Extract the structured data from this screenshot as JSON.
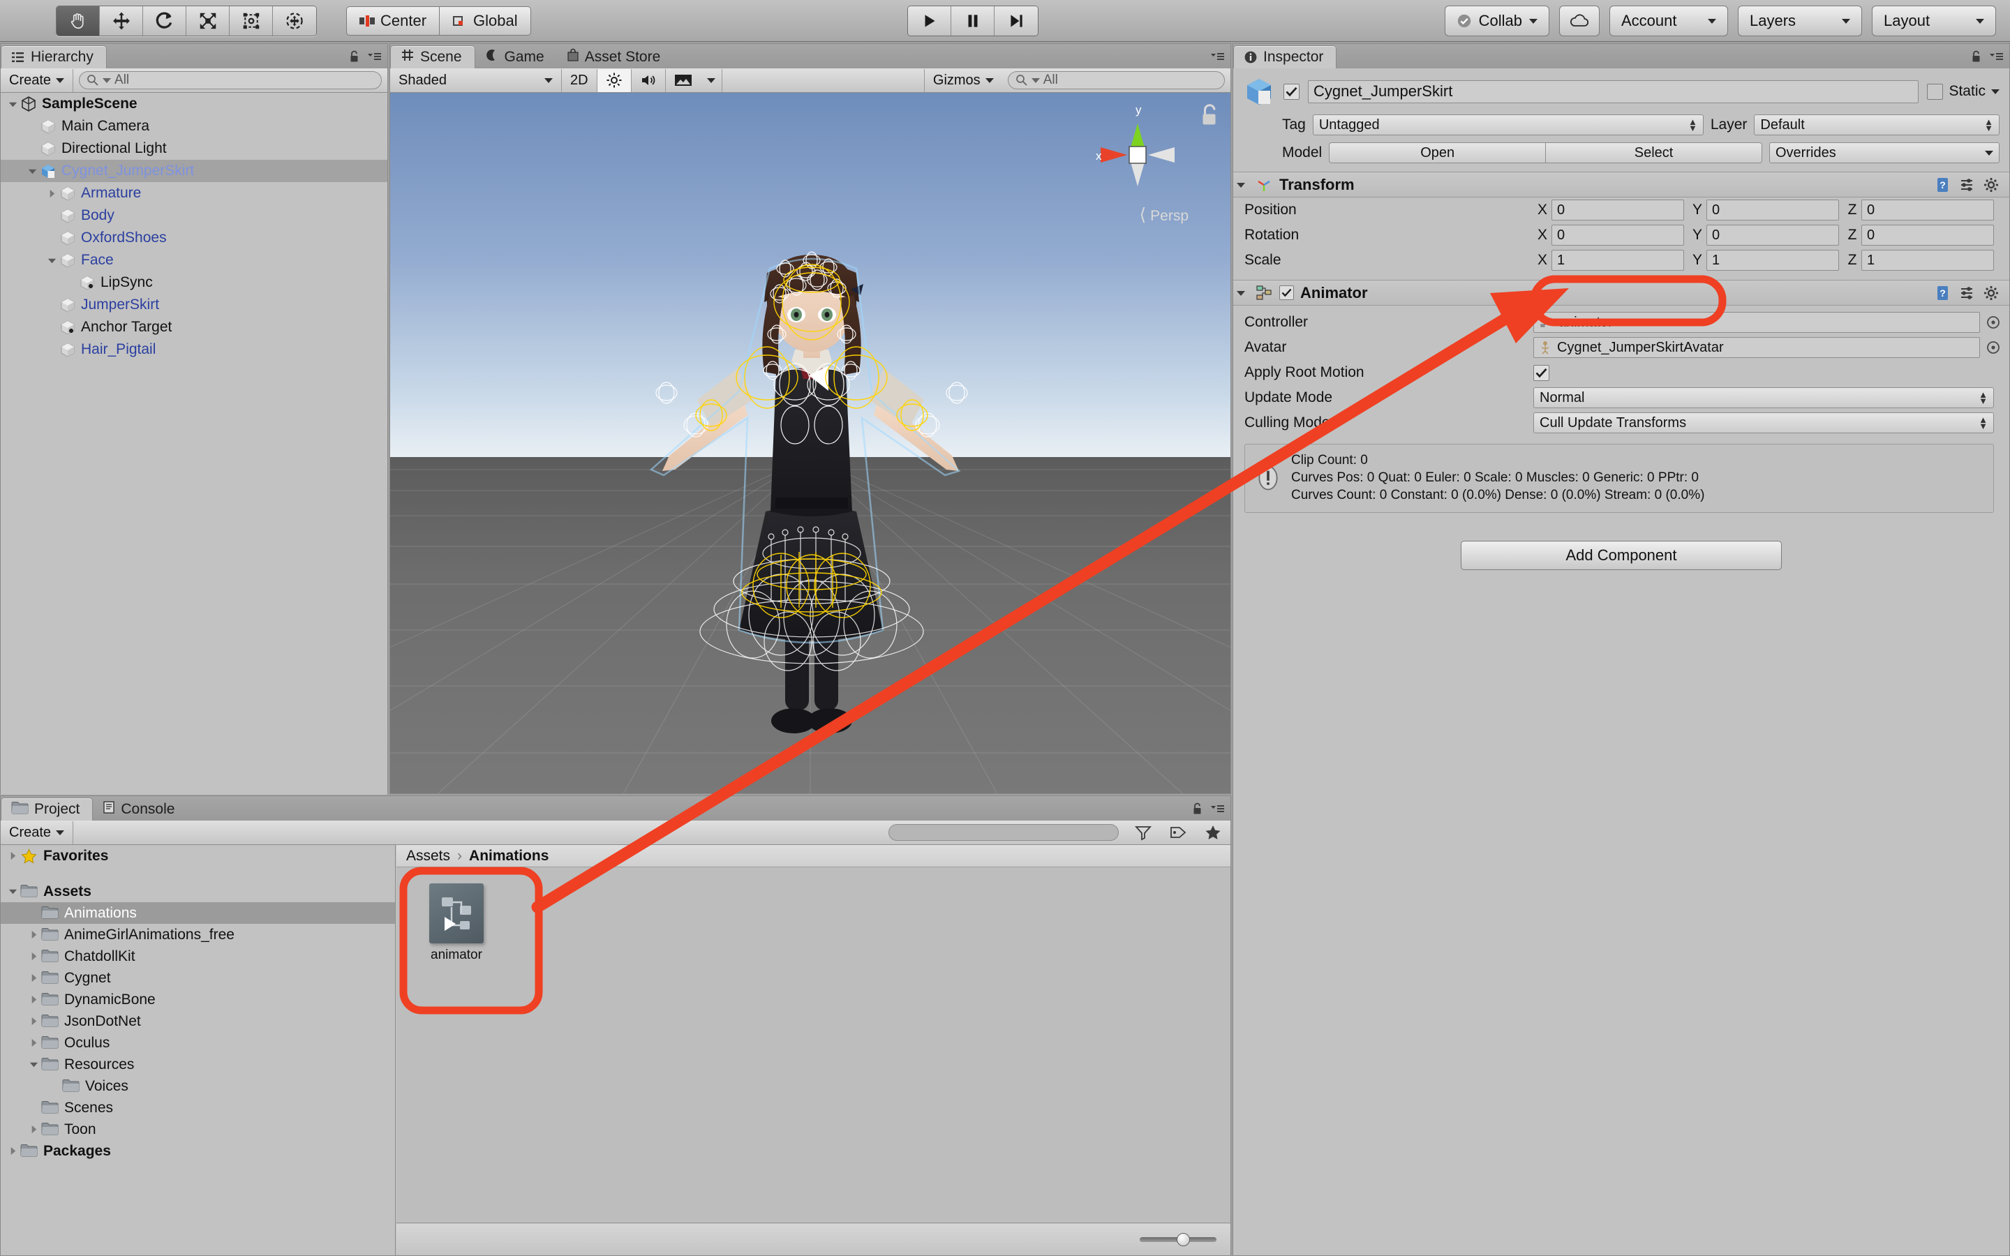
{
  "toolbar": {
    "tools": [
      {
        "name": "hand-tool",
        "icon": "hand",
        "active": true
      },
      {
        "name": "move-tool",
        "icon": "move",
        "active": false
      },
      {
        "name": "rotate-tool",
        "icon": "rotate",
        "active": false
      },
      {
        "name": "scale-tool",
        "icon": "scale",
        "active": false
      },
      {
        "name": "rect-tool",
        "icon": "rect",
        "active": false
      },
      {
        "name": "transform-tool",
        "icon": "transform",
        "active": false
      }
    ],
    "pivot_label": "Center",
    "space_label": "Global",
    "play_label": "play",
    "pause_label": "pause",
    "step_label": "step",
    "collab_label": "Collab",
    "cloud_label": "cloud",
    "account_label": "Account",
    "layers_label": "Layers",
    "layout_label": "Layout"
  },
  "hierarchy": {
    "tab_label": "Hierarchy",
    "create_label": "Create",
    "search_placeholder": "All",
    "items": [
      {
        "label": "SampleScene",
        "depth": 0,
        "arrow": "down",
        "icon": "unity",
        "style": "bold",
        "selected": false
      },
      {
        "label": "Main Camera",
        "depth": 1,
        "arrow": "none",
        "icon": "cube",
        "style": "normal",
        "selected": false
      },
      {
        "label": "Directional Light",
        "depth": 1,
        "arrow": "none",
        "icon": "cube",
        "style": "normal",
        "selected": false
      },
      {
        "label": "Cygnet_JumperSkirt",
        "depth": 1,
        "arrow": "down",
        "icon": "prefab",
        "style": "prefab-sel",
        "selected": true
      },
      {
        "label": "Armature",
        "depth": 2,
        "arrow": "right",
        "icon": "cube",
        "style": "prefab",
        "selected": false
      },
      {
        "label": "Body",
        "depth": 2,
        "arrow": "none",
        "icon": "cube",
        "style": "prefab",
        "selected": false
      },
      {
        "label": "OxfordShoes",
        "depth": 2,
        "arrow": "none",
        "icon": "cube",
        "style": "prefab",
        "selected": false
      },
      {
        "label": "Face",
        "depth": 2,
        "arrow": "down",
        "icon": "cube",
        "style": "prefab",
        "selected": false
      },
      {
        "label": "LipSync",
        "depth": 3,
        "arrow": "none",
        "icon": "cube-plus",
        "style": "normal",
        "selected": false
      },
      {
        "label": "JumperSkirt",
        "depth": 2,
        "arrow": "none",
        "icon": "cube",
        "style": "prefab",
        "selected": false
      },
      {
        "label": "Anchor Target",
        "depth": 2,
        "arrow": "none",
        "icon": "cube-plus",
        "style": "normal",
        "selected": false
      },
      {
        "label": "Hair_Pigtail",
        "depth": 2,
        "arrow": "none",
        "icon": "cube",
        "style": "prefab",
        "selected": false
      }
    ]
  },
  "scene": {
    "tabs": [
      {
        "label": "Scene",
        "icon": "grid-icon",
        "active": true
      },
      {
        "label": "Game",
        "icon": "gamepad-icon",
        "active": false
      },
      {
        "label": "Asset Store",
        "icon": "store-icon",
        "active": false
      }
    ],
    "draw_mode": "Shaded",
    "two_d_label": "2D",
    "lighting_icon": "sun-icon",
    "audio_icon": "speaker-icon",
    "effects_icon": "image-icon",
    "gizmos_label": "Gizmos",
    "search_placeholder": "All",
    "axis_x": "x",
    "axis_y": "y",
    "perspective_label": "Persp"
  },
  "inspector": {
    "tab_label": "Inspector",
    "object_name": "Cygnet_JumperSkirt",
    "enabled": true,
    "static_label": "Static",
    "tag_label": "Tag",
    "tag_value": "Untagged",
    "layer_label": "Layer",
    "layer_value": "Default",
    "model_label": "Model",
    "model_open": "Open",
    "model_select": "Select",
    "model_overrides": "Overrides",
    "transform": {
      "title": "Transform",
      "rows": [
        {
          "label": "Position",
          "x": "0",
          "y": "0",
          "z": "0"
        },
        {
          "label": "Rotation",
          "x": "0",
          "y": "0",
          "z": "0"
        },
        {
          "label": "Scale",
          "x": "1",
          "y": "1",
          "z": "1"
        }
      ],
      "axis_labels": [
        "X",
        "Y",
        "Z"
      ]
    },
    "animator": {
      "title": "Animator",
      "enabled": true,
      "controller_label": "Controller",
      "controller_value": "animator",
      "avatar_label": "Avatar",
      "avatar_value": "Cygnet_JumperSkirtAvatar",
      "apply_root_motion_label": "Apply Root Motion",
      "apply_root_motion_value": true,
      "update_mode_label": "Update Mode",
      "update_mode_value": "Normal",
      "culling_mode_label": "Culling Mode",
      "culling_mode_value": "Cull Update Transforms",
      "info_lines": [
        "Clip Count: 0",
        "Curves Pos: 0 Quat: 0 Euler: 0 Scale: 0 Muscles: 0 Generic: 0 PPtr: 0",
        "Curves Count: 0 Constant: 0 (0.0%) Dense: 0 (0.0%) Stream: 0 (0.0%)"
      ]
    },
    "add_component_label": "Add Component"
  },
  "project": {
    "tabs": [
      {
        "label": "Project",
        "icon": "folder-icon",
        "active": true
      },
      {
        "label": "Console",
        "icon": "console-icon",
        "active": false
      }
    ],
    "create_label": "Create",
    "tree": [
      {
        "label": "Favorites",
        "depth": 0,
        "arrow": "right",
        "icon": "star",
        "style": "bold",
        "selected": false
      },
      {
        "label": "",
        "depth": 0,
        "arrow": "none",
        "icon": "none",
        "style": "spacer",
        "selected": false
      },
      {
        "label": "Assets",
        "depth": 0,
        "arrow": "down",
        "icon": "folder",
        "style": "bold",
        "selected": false
      },
      {
        "label": "Animations",
        "depth": 1,
        "arrow": "none",
        "icon": "folder",
        "style": "normal",
        "selected": true
      },
      {
        "label": "AnimeGirlAnimations_free",
        "depth": 1,
        "arrow": "right",
        "icon": "folder",
        "style": "normal",
        "selected": false
      },
      {
        "label": "ChatdollKit",
        "depth": 1,
        "arrow": "right",
        "icon": "folder",
        "style": "normal",
        "selected": false
      },
      {
        "label": "Cygnet",
        "depth": 1,
        "arrow": "right",
        "icon": "folder",
        "style": "normal",
        "selected": false
      },
      {
        "label": "DynamicBone",
        "depth": 1,
        "arrow": "right",
        "icon": "folder",
        "style": "normal",
        "selected": false
      },
      {
        "label": "JsonDotNet",
        "depth": 1,
        "arrow": "right",
        "icon": "folder",
        "style": "normal",
        "selected": false
      },
      {
        "label": "Oculus",
        "depth": 1,
        "arrow": "right",
        "icon": "folder",
        "style": "normal",
        "selected": false
      },
      {
        "label": "Resources",
        "depth": 1,
        "arrow": "down",
        "icon": "folder",
        "style": "normal",
        "selected": false
      },
      {
        "label": "Voices",
        "depth": 2,
        "arrow": "none",
        "icon": "folder",
        "style": "normal",
        "selected": false
      },
      {
        "label": "Scenes",
        "depth": 1,
        "arrow": "none",
        "icon": "folder",
        "style": "normal",
        "selected": false
      },
      {
        "label": "Toon",
        "depth": 1,
        "arrow": "right",
        "icon": "folder",
        "style": "normal",
        "selected": false
      },
      {
        "label": "Packages",
        "depth": 0,
        "arrow": "right",
        "icon": "folder",
        "style": "bold",
        "selected": false
      }
    ],
    "breadcrumb": [
      "Assets",
      "Animations"
    ],
    "assets": [
      {
        "label": "animator",
        "icon": "animator-controller-icon"
      }
    ]
  },
  "annotation": {
    "accent_color": "#ef4023",
    "highlight_controller": true,
    "highlight_asset": true,
    "arrow": true
  }
}
